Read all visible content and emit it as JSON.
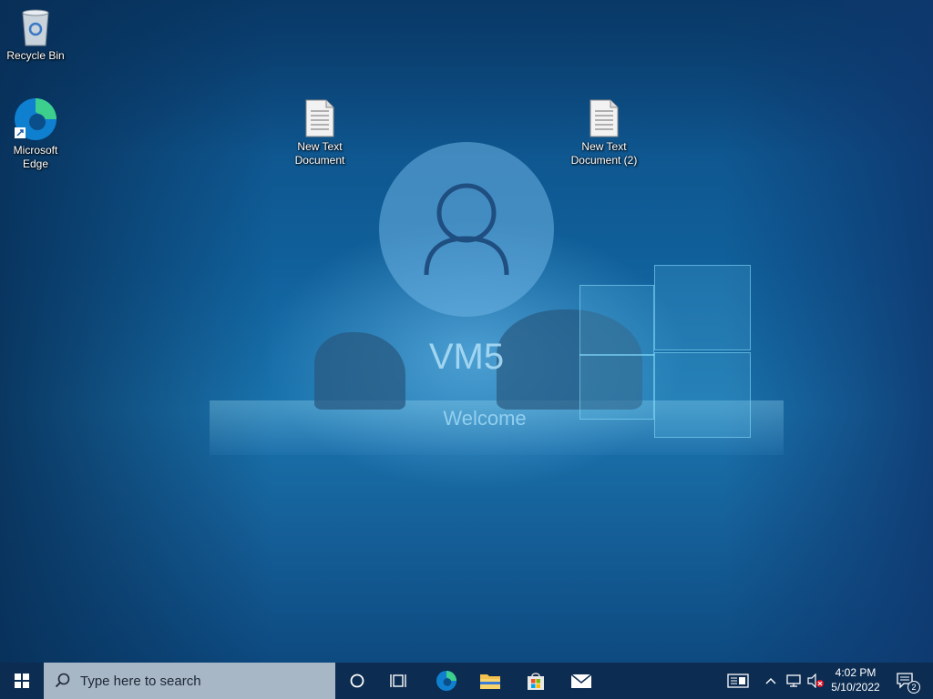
{
  "desktop": {
    "icons": [
      {
        "label": "Recycle Bin",
        "icon": "recycle-bin-icon"
      },
      {
        "label": "Microsoft Edge",
        "icon": "edge-icon"
      },
      {
        "label": "New Text Document",
        "icon": "text-document-icon"
      },
      {
        "label": "New Text Document (2)",
        "icon": "text-document-icon"
      }
    ]
  },
  "login": {
    "user_name": "VM5",
    "status": "Welcome",
    "avatar_icon": "user-avatar-icon"
  },
  "taskbar": {
    "search_placeholder": "Type here to search",
    "pinned": [
      {
        "name": "cortana-icon"
      },
      {
        "name": "task-view-icon"
      },
      {
        "name": "edge-icon"
      },
      {
        "name": "file-explorer-icon"
      },
      {
        "name": "store-icon"
      },
      {
        "name": "mail-icon"
      }
    ],
    "tray": {
      "time": "4:02 PM",
      "date": "5/10/2022",
      "notification_count": "2"
    }
  },
  "colors": {
    "taskbar": "#0c2c52",
    "search_box": "#a8b7c6",
    "accent": "#1a74ae"
  }
}
